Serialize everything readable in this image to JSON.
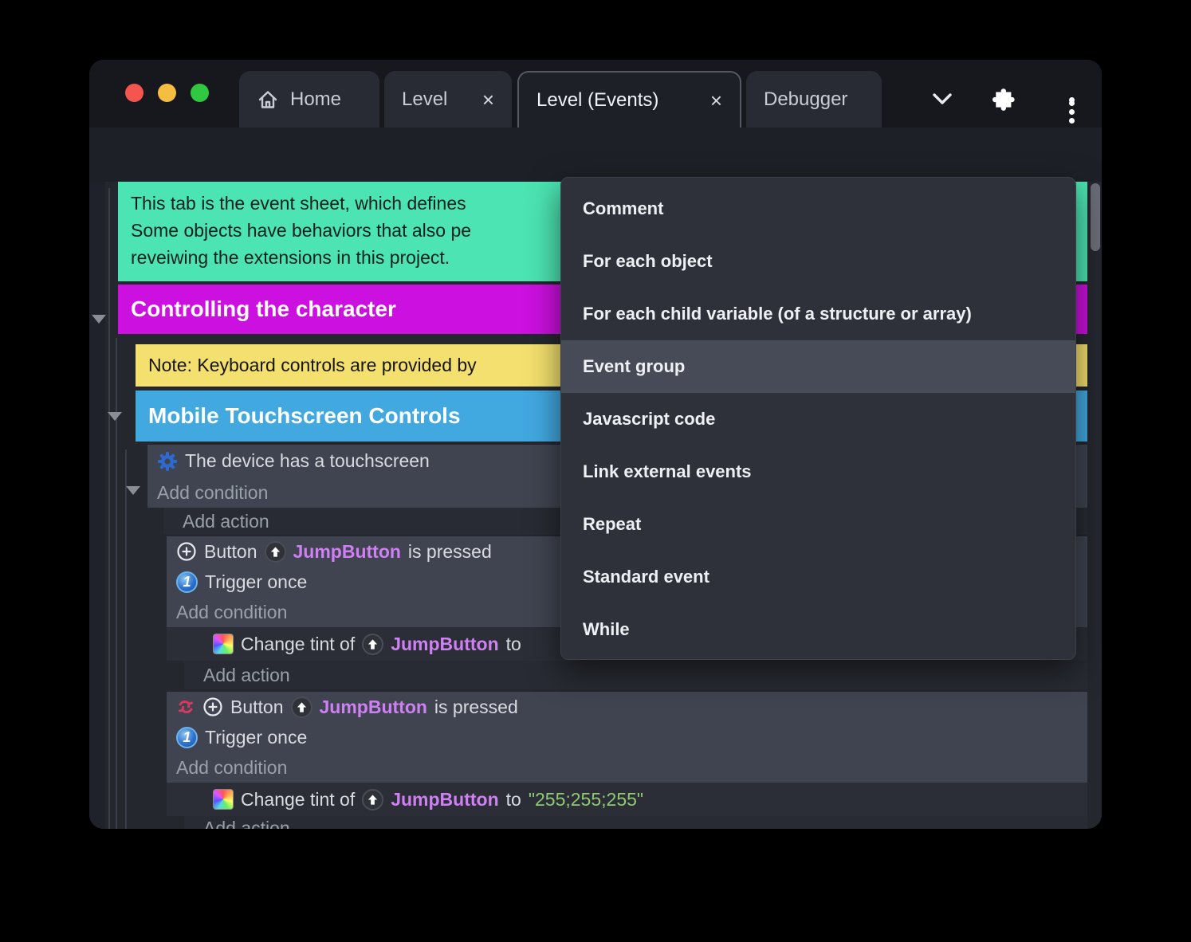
{
  "tabs": {
    "home": "Home",
    "level": "Level",
    "events": "Level (Events)",
    "debugger": "Debugger"
  },
  "tabbar": {
    "close_glyph": "×"
  },
  "menu": {
    "items": [
      "Comment",
      "For each object",
      "For each child variable (of a structure or array)",
      "Event group",
      "Javascript code",
      "Link external events",
      "Repeat",
      "Standard event",
      "While"
    ],
    "highlighted_item": "Event group"
  },
  "sheet": {
    "comment": {
      "line1": "This tab is the event sheet, which defines",
      "line2": "Some objects have behaviors that also pe",
      "line3": "reveiwing the extensions in this project."
    },
    "groups": {
      "controlling": "Controlling the character",
      "mobile": "Mobile Touchscreen Controls"
    },
    "note": "Note: Keyboard controls are provided by",
    "labels": {
      "add_condition": "Add condition",
      "add_action": "Add action",
      "device": "The device has a touchscreen",
      "button": "Button",
      "jump": "JumpButton",
      "pressed": "is pressed",
      "trigger": "Trigger once",
      "tint": "Change tint of",
      "to": "to",
      "value": "\"255;255;255\"",
      "once_glyph": "1"
    }
  },
  "colors": {
    "accent_purple": "#5a3bd7",
    "comment_green": "#4ce4b2",
    "group_magenta": "#cb10df",
    "note_yellow": "#f3e06e",
    "group_blue": "#42a8e0",
    "object_purple": "#cf80f2",
    "string_green": "#8fc973"
  }
}
